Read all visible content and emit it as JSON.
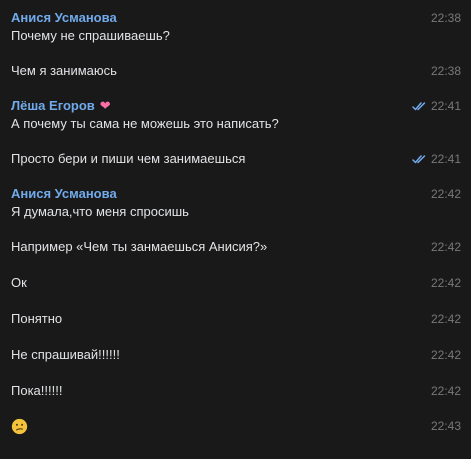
{
  "messages": [
    {
      "author": "Анися Усманова",
      "heart": false,
      "text": "Почему не спрашиваешь?",
      "time": "22:38",
      "read": false
    },
    {
      "author": null,
      "text": "Чем я занимаюсь",
      "time": "22:38",
      "read": false
    },
    {
      "author": "Лёша Егоров",
      "heart": true,
      "text": "А почему ты сама не можешь это написать?",
      "time": "22:41",
      "read": true
    },
    {
      "author": null,
      "text": "Просто бери и пиши чем занимаешься",
      "time": "22:41",
      "read": true
    },
    {
      "author": "Анися Усманова",
      "heart": false,
      "text": "Я думала,что меня спросишь",
      "time": "22:42",
      "read": false
    },
    {
      "author": null,
      "text": "Например «Чем ты занмаешься Анисия?»",
      "time": "22:42",
      "read": false
    },
    {
      "author": null,
      "text": "Ок",
      "time": "22:42",
      "read": false
    },
    {
      "author": null,
      "text": "Понятно",
      "time": "22:42",
      "read": false
    },
    {
      "author": null,
      "text": "Не спрашивай!!!!!!",
      "time": "22:42",
      "read": false
    },
    {
      "author": null,
      "text": "Пока!!!!!!",
      "time": "22:42",
      "read": false
    },
    {
      "author": null,
      "text": "",
      "emoji": "confused-face",
      "time": "22:43",
      "read": false
    }
  ],
  "colors": {
    "background": "#191919",
    "author": "#71aaeb",
    "text": "#e1e3e6",
    "time": "#76787a",
    "read_check": "#71aaeb",
    "heart": "#ff6fa6",
    "emoji": "#f5c33b"
  }
}
